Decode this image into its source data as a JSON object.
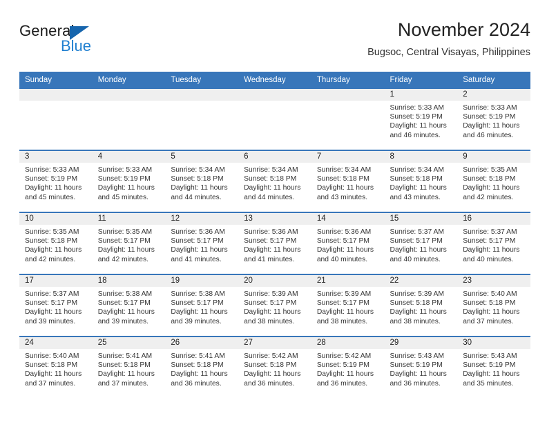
{
  "brand": {
    "name_part1": "General",
    "name_part2": "Blue",
    "flag_icon": "blue-triangle-flag-icon",
    "accent_color": "#1f7fd0",
    "flag_color": "#1665ad"
  },
  "header": {
    "title": "November 2024",
    "location": "Bugsoc, Central Visayas, Philippines"
  },
  "theme": {
    "header_row_bg": "#3876ba",
    "daynum_band_bg": "#efefef",
    "row_separator": "#3876ba",
    "text": "#333333"
  },
  "calendar": {
    "weekday_headers": [
      "Sunday",
      "Monday",
      "Tuesday",
      "Wednesday",
      "Thursday",
      "Friday",
      "Saturday"
    ],
    "labels": {
      "sunrise_prefix": "Sunrise:",
      "sunset_prefix": "Sunset:",
      "daylight_prefix": "Daylight:"
    },
    "weeks": [
      [
        {
          "day": "",
          "sunrise": "",
          "sunset": "",
          "daylight": ""
        },
        {
          "day": "",
          "sunrise": "",
          "sunset": "",
          "daylight": ""
        },
        {
          "day": "",
          "sunrise": "",
          "sunset": "",
          "daylight": ""
        },
        {
          "day": "",
          "sunrise": "",
          "sunset": "",
          "daylight": ""
        },
        {
          "day": "",
          "sunrise": "",
          "sunset": "",
          "daylight": ""
        },
        {
          "day": "1",
          "sunrise": "Sunrise: 5:33 AM",
          "sunset": "Sunset: 5:19 PM",
          "daylight": "Daylight: 11 hours and 46 minutes."
        },
        {
          "day": "2",
          "sunrise": "Sunrise: 5:33 AM",
          "sunset": "Sunset: 5:19 PM",
          "daylight": "Daylight: 11 hours and 46 minutes."
        }
      ],
      [
        {
          "day": "3",
          "sunrise": "Sunrise: 5:33 AM",
          "sunset": "Sunset: 5:19 PM",
          "daylight": "Daylight: 11 hours and 45 minutes."
        },
        {
          "day": "4",
          "sunrise": "Sunrise: 5:33 AM",
          "sunset": "Sunset: 5:19 PM",
          "daylight": "Daylight: 11 hours and 45 minutes."
        },
        {
          "day": "5",
          "sunrise": "Sunrise: 5:34 AM",
          "sunset": "Sunset: 5:18 PM",
          "daylight": "Daylight: 11 hours and 44 minutes."
        },
        {
          "day": "6",
          "sunrise": "Sunrise: 5:34 AM",
          "sunset": "Sunset: 5:18 PM",
          "daylight": "Daylight: 11 hours and 44 minutes."
        },
        {
          "day": "7",
          "sunrise": "Sunrise: 5:34 AM",
          "sunset": "Sunset: 5:18 PM",
          "daylight": "Daylight: 11 hours and 43 minutes."
        },
        {
          "day": "8",
          "sunrise": "Sunrise: 5:34 AM",
          "sunset": "Sunset: 5:18 PM",
          "daylight": "Daylight: 11 hours and 43 minutes."
        },
        {
          "day": "9",
          "sunrise": "Sunrise: 5:35 AM",
          "sunset": "Sunset: 5:18 PM",
          "daylight": "Daylight: 11 hours and 42 minutes."
        }
      ],
      [
        {
          "day": "10",
          "sunrise": "Sunrise: 5:35 AM",
          "sunset": "Sunset: 5:18 PM",
          "daylight": "Daylight: 11 hours and 42 minutes."
        },
        {
          "day": "11",
          "sunrise": "Sunrise: 5:35 AM",
          "sunset": "Sunset: 5:17 PM",
          "daylight": "Daylight: 11 hours and 42 minutes."
        },
        {
          "day": "12",
          "sunrise": "Sunrise: 5:36 AM",
          "sunset": "Sunset: 5:17 PM",
          "daylight": "Daylight: 11 hours and 41 minutes."
        },
        {
          "day": "13",
          "sunrise": "Sunrise: 5:36 AM",
          "sunset": "Sunset: 5:17 PM",
          "daylight": "Daylight: 11 hours and 41 minutes."
        },
        {
          "day": "14",
          "sunrise": "Sunrise: 5:36 AM",
          "sunset": "Sunset: 5:17 PM",
          "daylight": "Daylight: 11 hours and 40 minutes."
        },
        {
          "day": "15",
          "sunrise": "Sunrise: 5:37 AM",
          "sunset": "Sunset: 5:17 PM",
          "daylight": "Daylight: 11 hours and 40 minutes."
        },
        {
          "day": "16",
          "sunrise": "Sunrise: 5:37 AM",
          "sunset": "Sunset: 5:17 PM",
          "daylight": "Daylight: 11 hours and 40 minutes."
        }
      ],
      [
        {
          "day": "17",
          "sunrise": "Sunrise: 5:37 AM",
          "sunset": "Sunset: 5:17 PM",
          "daylight": "Daylight: 11 hours and 39 minutes."
        },
        {
          "day": "18",
          "sunrise": "Sunrise: 5:38 AM",
          "sunset": "Sunset: 5:17 PM",
          "daylight": "Daylight: 11 hours and 39 minutes."
        },
        {
          "day": "19",
          "sunrise": "Sunrise: 5:38 AM",
          "sunset": "Sunset: 5:17 PM",
          "daylight": "Daylight: 11 hours and 39 minutes."
        },
        {
          "day": "20",
          "sunrise": "Sunrise: 5:39 AM",
          "sunset": "Sunset: 5:17 PM",
          "daylight": "Daylight: 11 hours and 38 minutes."
        },
        {
          "day": "21",
          "sunrise": "Sunrise: 5:39 AM",
          "sunset": "Sunset: 5:17 PM",
          "daylight": "Daylight: 11 hours and 38 minutes."
        },
        {
          "day": "22",
          "sunrise": "Sunrise: 5:39 AM",
          "sunset": "Sunset: 5:18 PM",
          "daylight": "Daylight: 11 hours and 38 minutes."
        },
        {
          "day": "23",
          "sunrise": "Sunrise: 5:40 AM",
          "sunset": "Sunset: 5:18 PM",
          "daylight": "Daylight: 11 hours and 37 minutes."
        }
      ],
      [
        {
          "day": "24",
          "sunrise": "Sunrise: 5:40 AM",
          "sunset": "Sunset: 5:18 PM",
          "daylight": "Daylight: 11 hours and 37 minutes."
        },
        {
          "day": "25",
          "sunrise": "Sunrise: 5:41 AM",
          "sunset": "Sunset: 5:18 PM",
          "daylight": "Daylight: 11 hours and 37 minutes."
        },
        {
          "day": "26",
          "sunrise": "Sunrise: 5:41 AM",
          "sunset": "Sunset: 5:18 PM",
          "daylight": "Daylight: 11 hours and 36 minutes."
        },
        {
          "day": "27",
          "sunrise": "Sunrise: 5:42 AM",
          "sunset": "Sunset: 5:18 PM",
          "daylight": "Daylight: 11 hours and 36 minutes."
        },
        {
          "day": "28",
          "sunrise": "Sunrise: 5:42 AM",
          "sunset": "Sunset: 5:19 PM",
          "daylight": "Daylight: 11 hours and 36 minutes."
        },
        {
          "day": "29",
          "sunrise": "Sunrise: 5:43 AM",
          "sunset": "Sunset: 5:19 PM",
          "daylight": "Daylight: 11 hours and 36 minutes."
        },
        {
          "day": "30",
          "sunrise": "Sunrise: 5:43 AM",
          "sunset": "Sunset: 5:19 PM",
          "daylight": "Daylight: 11 hours and 35 minutes."
        }
      ]
    ]
  }
}
